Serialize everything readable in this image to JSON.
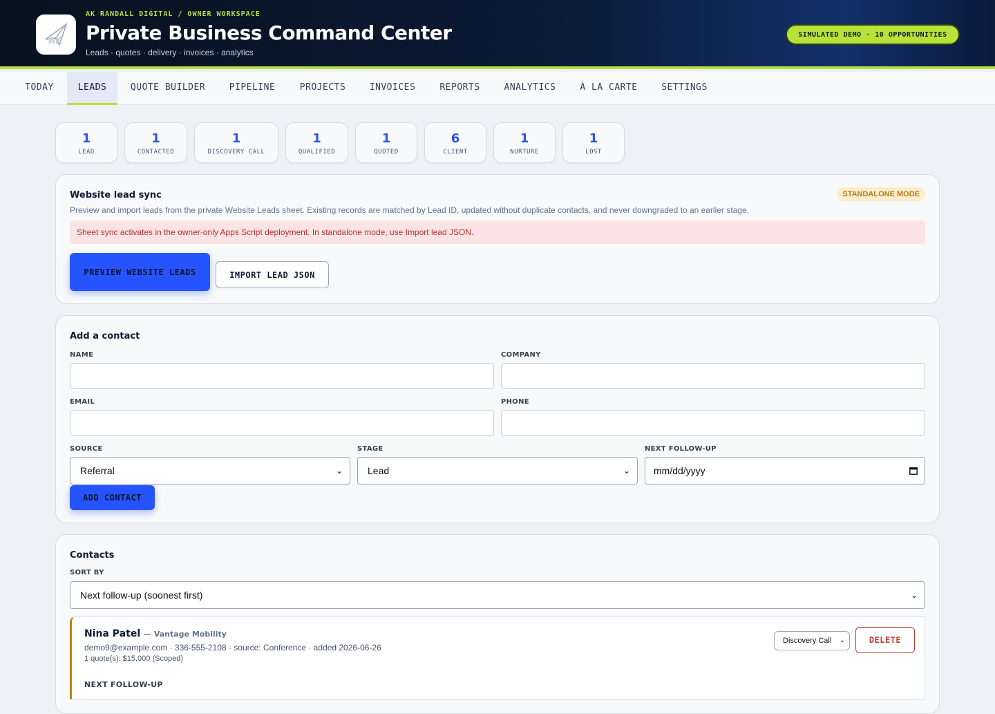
{
  "header": {
    "eyebrow": "AK RANDALL DIGITAL / OWNER WORKSPACE",
    "title": "Private Business Command Center",
    "subtitle": "Leads · quotes · delivery · invoices · analytics",
    "logo_text": "AK",
    "demo_pill": "SIMULATED DEMO · 10 OPPORTUNITIES"
  },
  "nav": {
    "tabs": [
      {
        "label": "TODAY"
      },
      {
        "label": "LEADS"
      },
      {
        "label": "QUOTE BUILDER"
      },
      {
        "label": "PIPELINE"
      },
      {
        "label": "PROJECTS"
      },
      {
        "label": "INVOICES"
      },
      {
        "label": "REPORTS"
      },
      {
        "label": "ANALYTICS"
      },
      {
        "label": "À LA CARTE"
      },
      {
        "label": "SETTINGS"
      }
    ],
    "active": "LEADS"
  },
  "stages": [
    {
      "count": "1",
      "label": "LEAD"
    },
    {
      "count": "1",
      "label": "CONTACTED"
    },
    {
      "count": "1",
      "label": "DISCOVERY CALL"
    },
    {
      "count": "1",
      "label": "QUALIFIED"
    },
    {
      "count": "1",
      "label": "QUOTED"
    },
    {
      "count": "6",
      "label": "CLIENT"
    },
    {
      "count": "1",
      "label": "NURTURE"
    },
    {
      "count": "1",
      "label": "LOST"
    }
  ],
  "sync": {
    "title": "Website lead sync",
    "badge": "STANDALONE MODE",
    "description": "Preview and import leads from the private Website Leads sheet. Existing records are matched by Lead ID, updated without duplicate contacts, and never downgraded to an earlier stage.",
    "alert": "Sheet sync activates in the owner-only Apps Script deployment. In standalone mode, use Import lead JSON.",
    "preview_button": "PREVIEW WEBSITE LEADS",
    "import_button": "IMPORT LEAD JSON"
  },
  "add_contact": {
    "title": "Add a contact",
    "name_label": "NAME",
    "company_label": "COMPANY",
    "email_label": "EMAIL",
    "phone_label": "PHONE",
    "source_label": "SOURCE",
    "source_value": "Referral",
    "stage_label": "STAGE",
    "stage_value": "Lead",
    "followup_label": "NEXT FOLLOW-UP",
    "followup_placeholder": "mm/dd/yyyy",
    "submit_button": "ADD CONTACT"
  },
  "contacts": {
    "title": "Contacts",
    "sort_label": "SORT BY",
    "sort_value": "Next follow-up (soonest first)",
    "items": [
      {
        "name": "Nina Patel",
        "company": "— Vantage Mobility",
        "details": "demo9@example.com · 336-555-2108 · source: Conference · added 2026-06-26",
        "quotes": "1 quote(s): $15,000 (Scoped)",
        "stage": "Discovery Call",
        "delete_button": "DELETE",
        "followup_label": "NEXT FOLLOW-UP"
      }
    ]
  },
  "colors": {
    "accent": "#b6e23a",
    "primary": "#2554ff",
    "count": "#2a54e8",
    "danger": "#c0392b",
    "warning_badge": "#b7791f"
  }
}
